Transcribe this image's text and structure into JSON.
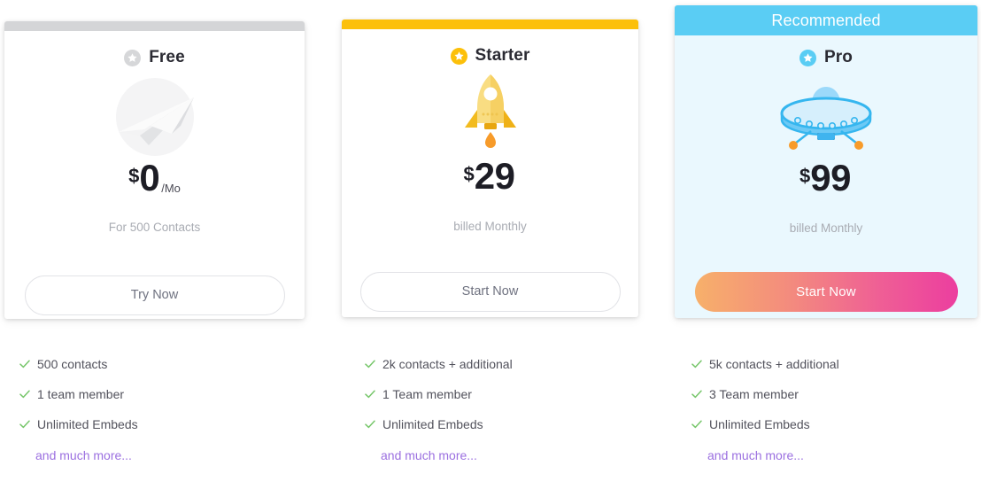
{
  "plans": [
    {
      "id": "free",
      "name": "Free",
      "badge": "",
      "star_icon": "star-circle-icon",
      "star_color": "#d6d7d9",
      "art_icon": "paper-plane-icon",
      "topbar_color": "#d4d5d7",
      "currency": "$",
      "amount": "0",
      "period": "/Mo",
      "billing_note": "For 500 Contacts",
      "cta_label": "Try Now",
      "cta_style": "ghost",
      "features": [
        "500 contacts",
        "1 team member",
        "Unlimited Embeds"
      ],
      "more_label": "and much more..."
    },
    {
      "id": "starter",
      "name": "Starter",
      "badge": "",
      "star_icon": "star-circle-icon",
      "star_color": "#fcc00a",
      "art_icon": "rocket-icon",
      "topbar_color": "#fcc00a",
      "currency": "$",
      "amount": "29",
      "period": "",
      "billing_note": "billed Monthly",
      "cta_label": "Start Now",
      "cta_style": "ghost",
      "features": [
        "2k contacts + additional",
        "1 Team member",
        "Unlimited Embeds"
      ],
      "more_label": "and much more..."
    },
    {
      "id": "pro",
      "name": "Pro",
      "badge": "Recommended",
      "star_icon": "star-circle-icon",
      "star_color": "#5acdf4",
      "art_icon": "ufo-icon",
      "topbar_color": "#5acdf4",
      "currency": "$",
      "amount": "99",
      "period": "",
      "billing_note": "billed Monthly",
      "cta_label": "Start Now",
      "cta_style": "gradient",
      "features": [
        "5k contacts + additional",
        "3 Team member",
        "Unlimited Embeds"
      ],
      "more_label": "and much more..."
    }
  ],
  "colors": {
    "recommended_banner": "#5acdf4",
    "pro_card_background": "#eaf8fe",
    "starter_topbar": "#fcc00a",
    "free_topbar": "#d4d5d7",
    "check_green": "#76c66a",
    "more_link_purple": "#9b6fe0",
    "cta_gradient_start": "#f7b06a",
    "cta_gradient_end": "#ec3e9f",
    "muted_text": "#a9acb3",
    "feature_text": "#52525c"
  },
  "icons": {
    "check": "check-icon",
    "star": "star-circle-icon"
  }
}
